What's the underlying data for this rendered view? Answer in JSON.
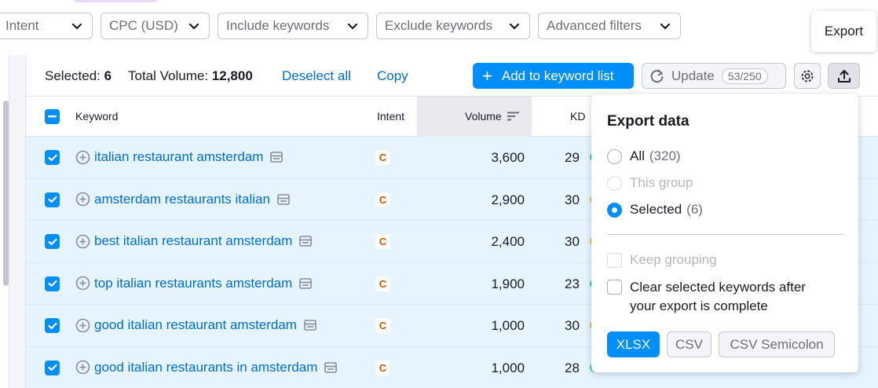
{
  "filters": {
    "intent": "Intent",
    "cpc": "CPC (USD)",
    "include": "Include keywords",
    "exclude": "Exclude keywords",
    "advanced": "Advanced filters"
  },
  "tooltip": "Export",
  "toolbar": {
    "selected_label": "Selected:",
    "selected_count": "6",
    "volume_label": "Total Volume:",
    "volume_value": "12,800",
    "deselect_all": "Deselect all",
    "copy": "Copy",
    "add_to_list": "Add to keyword list",
    "update": "Update",
    "update_badge": "53/250"
  },
  "table": {
    "headers": {
      "keyword": "Keyword",
      "intent": "Intent",
      "volume": "Volume",
      "kd": "KD"
    },
    "rows": [
      {
        "keyword": "italian restaurant amsterdam",
        "intent": "C",
        "volume": "3,600",
        "kd": "29",
        "kd_color": "#2bd4a0"
      },
      {
        "keyword": "amsterdam restaurants italian",
        "intent": "C",
        "volume": "2,900",
        "kd": "30",
        "kd_color": "#f5b63a"
      },
      {
        "keyword": "best italian restaurant amsterdam",
        "intent": "C",
        "volume": "2,400",
        "kd": "30",
        "kd_color": "#f5b63a"
      },
      {
        "keyword": "top italian restaurants amsterdam",
        "intent": "C",
        "volume": "1,900",
        "kd": "23",
        "kd_color": "#2bd4a0"
      },
      {
        "keyword": "good italian restaurant amsterdam",
        "intent": "C",
        "volume": "1,000",
        "kd": "30",
        "kd_color": "#f5b63a"
      },
      {
        "keyword": "good italian restaurants in amsterdam",
        "intent": "C",
        "volume": "1,000",
        "kd": "28",
        "kd_color": "#2bd4a0"
      }
    ]
  },
  "export_popup": {
    "title": "Export data",
    "options": {
      "all_label": "All",
      "all_count": "(320)",
      "group_label": "This group",
      "selected_label": "Selected",
      "selected_count": "(6)"
    },
    "keep_grouping": "Keep grouping",
    "clear_selected": "Clear selected keywords after your export is complete",
    "formats": {
      "xlsx": "XLSX",
      "csv": "CSV",
      "csv_semicolon": "CSV Semicolon"
    }
  },
  "colors": {
    "accent": "#008ff8",
    "link": "#006dca",
    "row_selected": "#e6f4ff",
    "intent_commercial": "#c75800"
  }
}
